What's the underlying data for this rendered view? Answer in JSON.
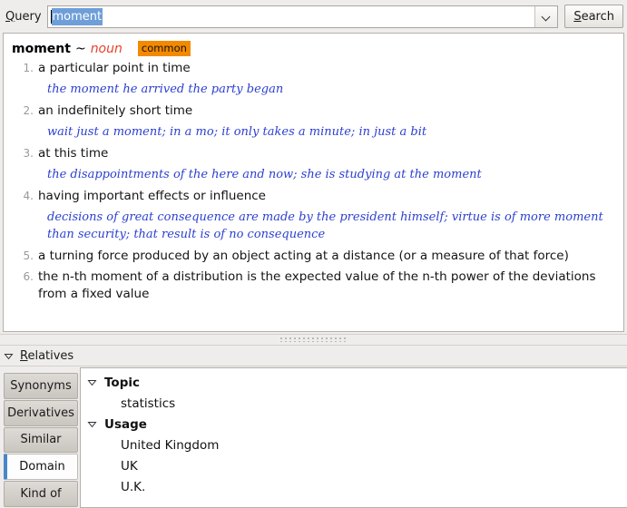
{
  "toolbar": {
    "query_label_prefix": "Q",
    "query_label_rest": "uery",
    "query_value": "moment",
    "query_placeholder": "",
    "dropdown_icon": "chevron-down-icon",
    "search_label_prefix": "S",
    "search_label_rest": "earch"
  },
  "entry": {
    "headword": "moment",
    "separator": "~",
    "pos": "noun",
    "badge": "common",
    "badge_color": "#f28a00",
    "pos_color": "#e8402a",
    "example_color": "#2b3fd0",
    "senses": [
      {
        "num": "1.",
        "text": "a particular point in time",
        "example": "the moment he arrived the party began"
      },
      {
        "num": "2.",
        "text": "an indefinitely short time",
        "example": "wait just a moment; in a mo; it only takes a minute; in just a bit"
      },
      {
        "num": "3.",
        "text": "at this time",
        "example": "the disappointments of the here and now; she is studying at the moment"
      },
      {
        "num": "4.",
        "text": "having important effects or influence",
        "example": "decisions of great consequence are made by the president himself; virtue is of more moment than security; that result is of no consequence"
      },
      {
        "num": "5.",
        "text": "a turning force produced by an object acting at a distance (or a measure of that force)",
        "example": ""
      },
      {
        "num": "6.",
        "text": "the n-th moment of a distribution is the expected value of the n-th power of the deviations from a fixed value",
        "example": ""
      }
    ]
  },
  "splitter": {
    "grip_icon": "drag-grip-icon"
  },
  "relatives": {
    "toggle_icon": "triangle-down-icon",
    "label_prefix": "R",
    "label_rest": "elatives"
  },
  "tabs": [
    {
      "label": "Synonyms",
      "selected": false
    },
    {
      "label": "Derivatives",
      "selected": false
    },
    {
      "label": "Similar",
      "selected": false
    },
    {
      "label": "Domain",
      "selected": true
    },
    {
      "label": "Kind of",
      "selected": false
    }
  ],
  "tab_accent_color": "#4a86c8",
  "tree": [
    {
      "label": "Topic",
      "group": true,
      "toggle_icon": "triangle-down-icon"
    },
    {
      "label": "statistics",
      "group": false,
      "toggle_icon": ""
    },
    {
      "label": "Usage",
      "group": true,
      "toggle_icon": "triangle-down-icon"
    },
    {
      "label": "United Kingdom",
      "group": false,
      "toggle_icon": ""
    },
    {
      "label": "UK",
      "group": false,
      "toggle_icon": ""
    },
    {
      "label": "U.K.",
      "group": false,
      "toggle_icon": ""
    }
  ]
}
